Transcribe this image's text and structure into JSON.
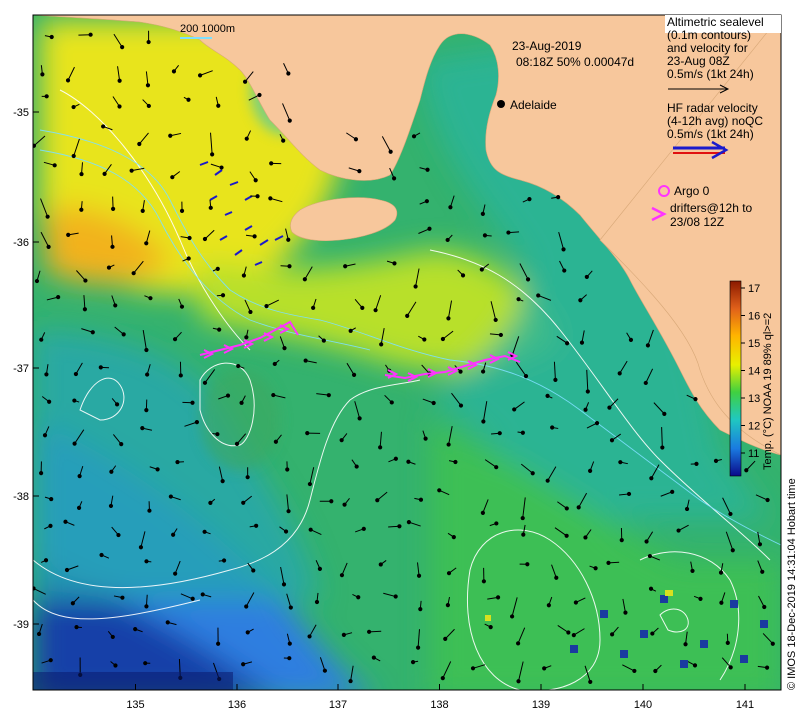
{
  "map": {
    "date": "23-Aug-2019",
    "time_line": "08:18Z  50% 0.00047d",
    "scale_bar": "200  1000m",
    "city": "Adelaide",
    "lon_ticks": [
      "135",
      "136",
      "137",
      "138",
      "139",
      "140",
      "141"
    ],
    "lat_ticks": [
      "-35",
      "-36",
      "-37",
      "-38",
      "-39"
    ]
  },
  "legend": {
    "sealevel": [
      "Altimetric sealevel",
      "(0.1m contours)",
      "and velocity for",
      "23-Aug 08Z",
      "0.5m/s (1kt 24h)"
    ],
    "hf_radar": [
      "HF radar velocity",
      "(4-12h avg) noQC",
      "0.5m/s (1kt 24h)"
    ],
    "argo": "Argo 0",
    "drifters": [
      "drifters@12h to",
      "23/08 12Z"
    ]
  },
  "colorbar": {
    "ticks": [
      "17",
      "16",
      "15",
      "14",
      "13",
      "12",
      "11"
    ],
    "label": "Temp. (°C) NOAA 19 89% ql>=2"
  },
  "footer": "© IMOS 18-Dec-2019 14:31:04 Hobart time",
  "colors": {
    "land": "#f7c79c",
    "drifter": "#ff33ff",
    "hf_radar": "#1a1acc",
    "contour": "#ffffff"
  }
}
